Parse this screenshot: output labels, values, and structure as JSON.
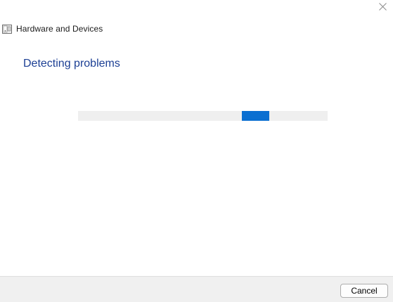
{
  "window": {
    "title": "Hardware and Devices",
    "close_icon": "close-icon",
    "app_icon": "troubleshooter-icon"
  },
  "main": {
    "heading": "Detecting problems",
    "progress": {
      "style": "indeterminate-marquee",
      "visible_chunk_start": 0.655,
      "visible_chunk_width": 0.11
    }
  },
  "footer": {
    "cancel_label": "Cancel"
  },
  "colors": {
    "heading": "#1c3f94",
    "progress_track": "#efefef",
    "progress_fill": "#0a6fd1",
    "footer_bg": "#f0f0f0"
  }
}
